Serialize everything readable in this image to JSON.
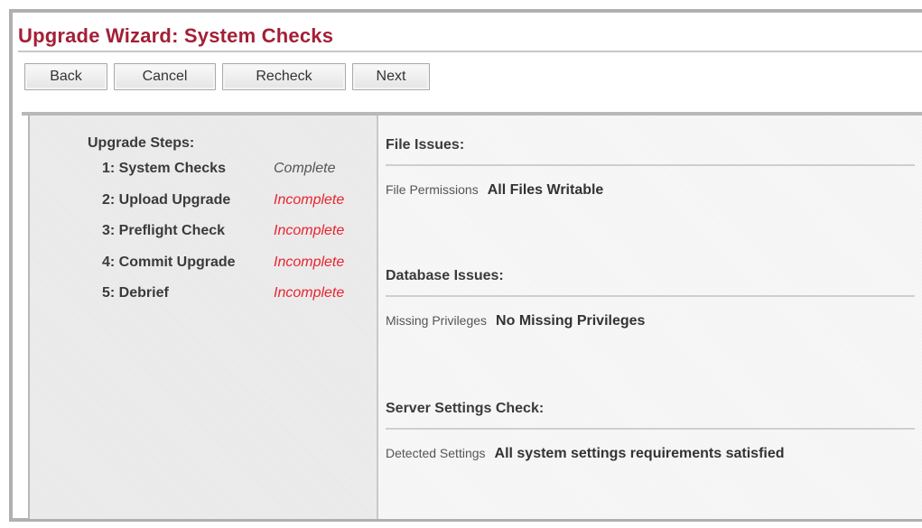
{
  "header": {
    "title": "Upgrade Wizard: System Checks"
  },
  "toolbar": {
    "back_label": "Back",
    "cancel_label": "Cancel",
    "recheck_label": "Recheck",
    "next_label": "Next"
  },
  "sidebar": {
    "heading": "Upgrade Steps:",
    "steps": [
      {
        "label": "1: System Checks",
        "status": "Complete"
      },
      {
        "label": "2: Upload Upgrade",
        "status": "Incomplete"
      },
      {
        "label": "3: Preflight Check",
        "status": "Incomplete"
      },
      {
        "label": "4: Commit Upgrade",
        "status": "Incomplete"
      },
      {
        "label": "5: Debrief",
        "status": "Incomplete"
      }
    ]
  },
  "main": {
    "sections": [
      {
        "heading": "File Issues:",
        "label": "File Permissions",
        "value": "All Files Writable"
      },
      {
        "heading": "Database Issues:",
        "label": "Missing Privileges",
        "value": "No Missing Privileges"
      },
      {
        "heading": "Server Settings Check:",
        "label": "Detected Settings",
        "value": "All system settings requirements satisfied"
      }
    ]
  },
  "colors": {
    "title": "#a31f37",
    "complete": "#555555",
    "incomplete": "#e8242f"
  }
}
